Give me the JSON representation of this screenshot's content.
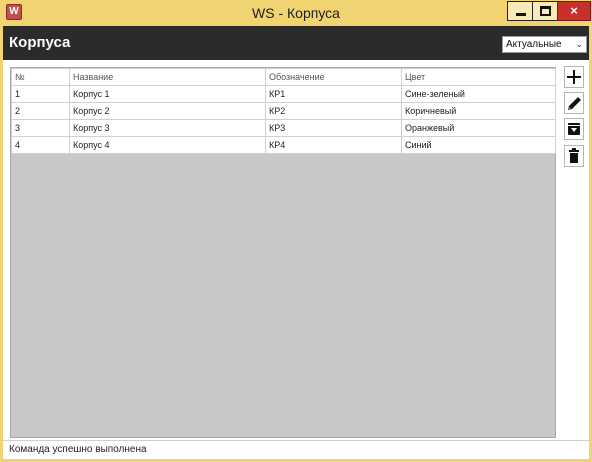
{
  "window": {
    "app_icon": "W",
    "title": "WS - Корпуса",
    "minimize_icon": "minimize-icon",
    "maximize_icon": "maximize-icon",
    "close_icon": "×"
  },
  "header": {
    "title": "Корпуса",
    "filter": {
      "selected": "Актуальные",
      "chevron": "⌄"
    }
  },
  "grid": {
    "columns": [
      "№",
      "Название",
      "Обозначение",
      "Цвет"
    ],
    "rows": [
      [
        "1",
        "Корпус 1",
        "КР1",
        "Сине-зеленый"
      ],
      [
        "2",
        "Корпус 2",
        "КР2",
        "Коричневый"
      ],
      [
        "3",
        "Корпус 3",
        "КР3",
        "Оранжевый"
      ],
      [
        "4",
        "Корпус 4",
        "КР4",
        "Синий"
      ]
    ]
  },
  "toolbar": {
    "buttons": [
      {
        "icon": "plus-icon"
      },
      {
        "icon": "pencil-icon"
      },
      {
        "icon": "archive-icon"
      },
      {
        "icon": "trash-icon"
      }
    ]
  },
  "status": {
    "text": "Команда успешно выполнена"
  }
}
